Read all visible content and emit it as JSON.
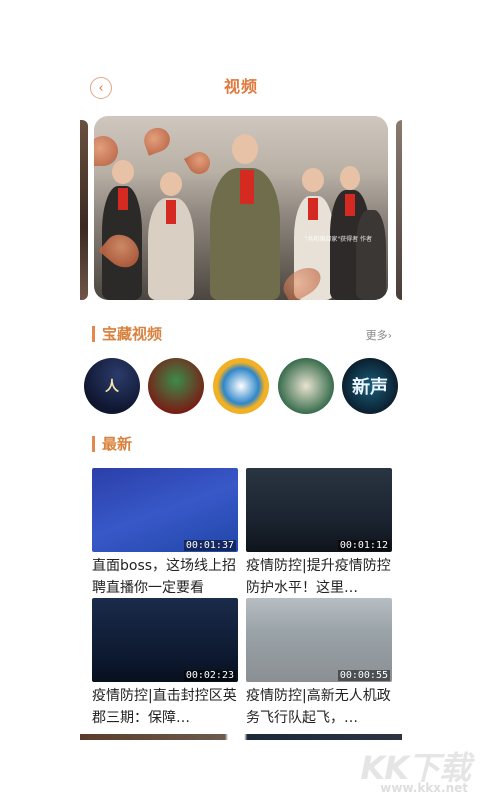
{
  "header": {
    "title": "视频",
    "back_icon": "chevron-left-icon"
  },
  "banner": {
    "caption": "\"共和国部家\"获得者    作者"
  },
  "treasure": {
    "title": "宝藏视频",
    "more": "更多›"
  },
  "latest": {
    "title": "最新"
  },
  "circle_cards": [
    {
      "name": "circle-card-1",
      "text": "人"
    },
    {
      "name": "circle-card-2",
      "text": ""
    },
    {
      "name": "circle-card-3",
      "text": ""
    },
    {
      "name": "circle-card-4",
      "text": ""
    },
    {
      "name": "circle-card-5",
      "text": "新声"
    }
  ],
  "videos": [
    {
      "title": "直面boss，这场线上招聘直播你一定要看",
      "duration": "00:01:37"
    },
    {
      "title": "疫情防控|提升疫情防控防护水平！这里…",
      "duration": "00:01:12"
    },
    {
      "title": "疫情防控|直击封控区英郡三期：保障…",
      "duration": "00:02:23"
    },
    {
      "title": "疫情防控|高新无人机政务飞行队起飞，…",
      "duration": "00:00:55"
    }
  ],
  "watermark": {
    "main": "KK下载",
    "url": "www.kkx.net"
  },
  "colors": {
    "accent": "#e07a3e",
    "section": "#d9823f"
  }
}
